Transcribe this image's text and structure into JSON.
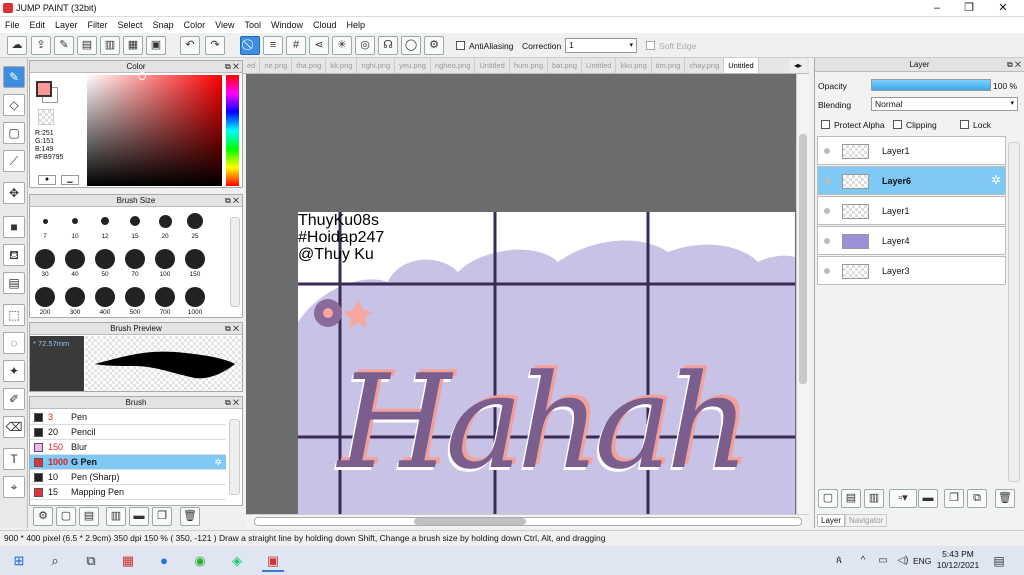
{
  "window": {
    "title": "JUMP PAINT (32bit)",
    "min": "–",
    "max": "❐",
    "close": "✕"
  },
  "menu": [
    "File",
    "Edit",
    "Layer",
    "Filter",
    "Select",
    "Snap",
    "Color",
    "View",
    "Tool",
    "Window",
    "Cloud",
    "Help"
  ],
  "toolbar": {
    "antialias_label": "AntiAliasing",
    "correction_label": "Correction",
    "correction_value": "1",
    "soft_edge_label": "Soft Edge"
  },
  "color_panel": {
    "title": "Color",
    "r": "R:251",
    "g": "G:151",
    "b": "B:149",
    "hex": "#FB9795",
    "fg": "#FB9795"
  },
  "brush_size": {
    "title": "Brush Size",
    "sizes": [
      "7",
      "10",
      "12",
      "15",
      "20",
      "25",
      "30",
      "40",
      "50",
      "70",
      "100",
      "150",
      "200",
      "300",
      "400",
      "500",
      "700",
      "1000"
    ]
  },
  "brush_preview": {
    "title": "Brush Preview",
    "size_text": "* 72.57mm"
  },
  "brush": {
    "title": "Brush",
    "items": [
      {
        "size": "3",
        "name": "Pen",
        "color": "#222222",
        "sizecolor": "#d22"
      },
      {
        "size": "20",
        "name": "Pencil",
        "color": "#222222",
        "sizecolor": "#111"
      },
      {
        "size": "150",
        "name": "Blur",
        "color": "#f5b3f0",
        "sizecolor": "#d22"
      },
      {
        "size": "1000",
        "name": "G Pen",
        "color": "#e3323d",
        "sizecolor": "#d22"
      },
      {
        "size": "10",
        "name": "Pen (Sharp)",
        "color": "#222222",
        "sizecolor": "#111"
      },
      {
        "size": "15",
        "name": "Mapping Pen",
        "color": "#e3323d",
        "sizecolor": "#111"
      }
    ]
  },
  "tabs": [
    "ed",
    "ne.png",
    "tha.png",
    "kk.png",
    "nghi.png",
    "yeu.png",
    "ngheo.png",
    "Untitled",
    "hum.png",
    "bat.png",
    "Untitled",
    "kko.png",
    "tim.png",
    "chay.png",
    "Untitled"
  ],
  "artwork": {
    "line1": "ThuyKu08s",
    "line2": "#Hoidap247",
    "line3": "@Thuy Ku",
    "big": "Hahah"
  },
  "layer_panel": {
    "title": "Layer",
    "opacity_label": "Opacity",
    "opacity_value": "100 %",
    "opacity_fraction": 1.0,
    "blending_label": "Blending",
    "blending_value": "Normal",
    "protect_alpha": "Protect Alpha",
    "clipping": "Clipping",
    "lock": "Lock",
    "layers": [
      "Layer1",
      "Layer6",
      "Layer1",
      "Layer4",
      "Layer3"
    ],
    "tab_layer": "Layer",
    "tab_navigator": "Navigator"
  },
  "status": {
    "text": "900 * 400 pixel   (6.5 * 2.9cm)   350 dpi   150 %   ( 350, -121 )   Draw a straight line by holding down Shift, Change a brush size by holding down Ctrl, Alt, and dragging"
  },
  "taskbar": {
    "lang": "ENG",
    "time": "5:43 PM",
    "date": "10/12/2021"
  }
}
